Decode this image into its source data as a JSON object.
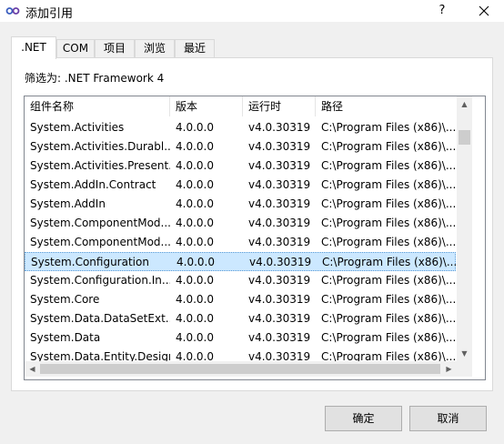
{
  "window": {
    "title": "添加引用",
    "help_label": "?",
    "icon": "link-icon",
    "close_icon": "close-icon"
  },
  "tabs": [
    {
      "label": ".NET",
      "active": true
    },
    {
      "label": "COM",
      "active": false
    },
    {
      "label": "项目",
      "active": false
    },
    {
      "label": "浏览",
      "active": false
    },
    {
      "label": "最近",
      "active": false
    }
  ],
  "filter": {
    "label": "筛选为: .NET Framework 4"
  },
  "columns": [
    "组件名称",
    "版本",
    "运行时",
    "路径"
  ],
  "rows": [
    [
      "System.Activities",
      "4.0.0.0",
      "v4.0.30319",
      "C:\\Program Files (x86)\\..."
    ],
    [
      "System.Activities.Durabl...",
      "4.0.0.0",
      "v4.0.30319",
      "C:\\Program Files (x86)\\..."
    ],
    [
      "System.Activities.Present...",
      "4.0.0.0",
      "v4.0.30319",
      "C:\\Program Files (x86)\\..."
    ],
    [
      "System.AddIn.Contract",
      "4.0.0.0",
      "v4.0.30319",
      "C:\\Program Files (x86)\\..."
    ],
    [
      "System.AddIn",
      "4.0.0.0",
      "v4.0.30319",
      "C:\\Program Files (x86)\\..."
    ],
    [
      "System.ComponentMod...",
      "4.0.0.0",
      "v4.0.30319",
      "C:\\Program Files (x86)\\..."
    ],
    [
      "System.ComponentMod...",
      "4.0.0.0",
      "v4.0.30319",
      "C:\\Program Files (x86)\\..."
    ],
    [
      "System.Configuration",
      "4.0.0.0",
      "v4.0.30319",
      "C:\\Program Files (x86)\\..."
    ],
    [
      "System.Configuration.In...",
      "4.0.0.0",
      "v4.0.30319",
      "C:\\Program Files (x86)\\..."
    ],
    [
      "System.Core",
      "4.0.0.0",
      "v4.0.30319",
      "C:\\Program Files (x86)\\..."
    ],
    [
      "System.Data.DataSetExt...",
      "4.0.0.0",
      "v4.0.30319",
      "C:\\Program Files (x86)\\..."
    ],
    [
      "System.Data",
      "4.0.0.0",
      "v4.0.30319",
      "C:\\Program Files (x86)\\..."
    ],
    [
      "System.Data.Entity.Design",
      "4.0.0.0",
      "v4.0.30319",
      "C:\\Program Files (x86)\\..."
    ]
  ],
  "selected_row": 7,
  "scroll_icons": {
    "up": "chevron-up-icon",
    "down": "chevron-down-icon",
    "left": "chevron-left-icon",
    "right": "chevron-right-icon"
  },
  "buttons": {
    "ok": "确定",
    "cancel": "取消"
  }
}
